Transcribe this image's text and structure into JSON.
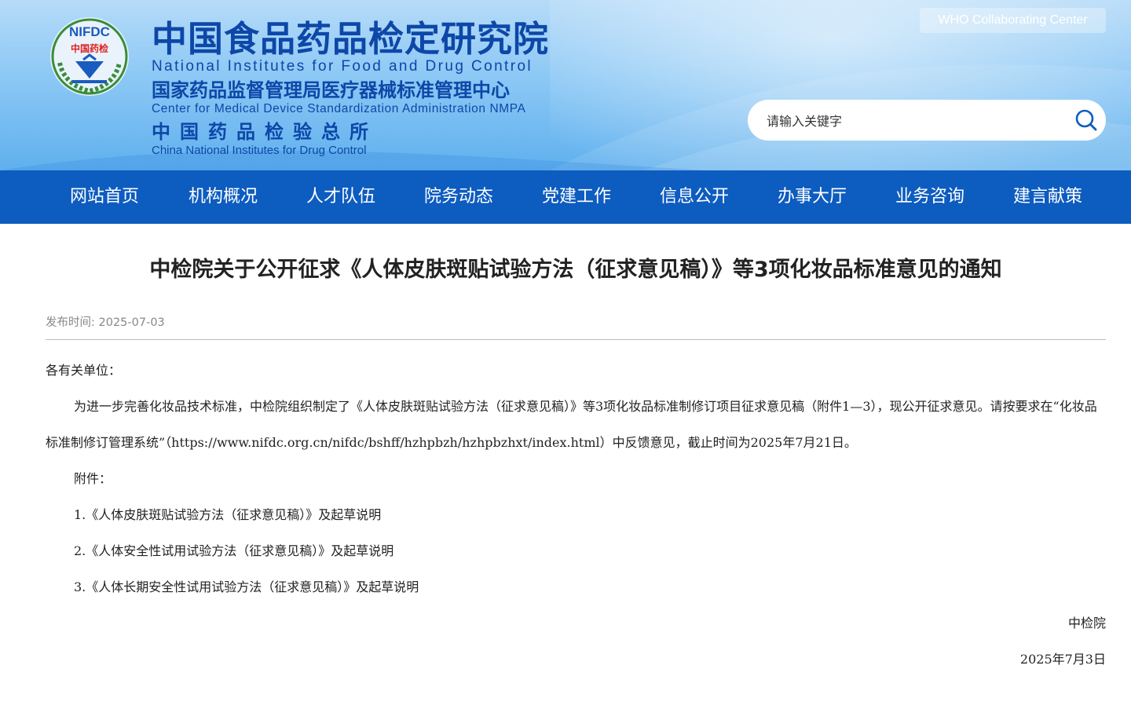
{
  "header": {
    "logo_ring_text": "NIFDC",
    "logo_center_text": "中国药检",
    "cn_title": "中国食品药品检定研究院",
    "en_title": "National Institutes for Food and Drug Control",
    "cn_sub1": "国家药品监督管理局医疗器械标准管理中心",
    "en_sub1": "Center for Medical Device Standardization Administration NMPA",
    "cn_sub2": "中国药品检验总所",
    "en_sub2": "China National Institutes for Drug Control",
    "who_badge": "WHO Collaborating Center",
    "search_placeholder": "请输入关键字",
    "colors": {
      "title": "#0d47a8",
      "nav": "#0d5cc0"
    }
  },
  "nav": {
    "items": [
      "网站首页",
      "机构概况",
      "人才队伍",
      "院务动态",
      "党建工作",
      "信息公开",
      "办事大厅",
      "业务咨询",
      "建言献策"
    ]
  },
  "article": {
    "title": "中检院关于公开征求《人体皮肤斑贴试验方法（征求意见稿）》等3项化妆品标准意见的通知",
    "publish_label": "发布时间:",
    "publish_date": "2025-07-03",
    "salutation": "各有关单位：",
    "body": "为进一步完善化妆品技术标准，中检院组织制定了《人体皮肤斑贴试验方法（征求意见稿）》等3项化妆品标准制修订项目征求意见稿（附件1—3），现公开征求意见。请按要求在“化妆品标准制修订管理系统”（https://www.nifdc.org.cn/nifdc/bshff/hzhpbzh/hzhpbzhxt/index.html）中反馈意见，截止时间为2025年7月21日。",
    "attachments_label": "附件：",
    "attachments": [
      "1.《人体皮肤斑贴试验方法（征求意见稿）》及起草说明",
      "2.《人体安全性试用试验方法（征求意见稿）》及起草说明",
      "3.《人体长期安全性试用试验方法（征求意见稿）》及起草说明"
    ],
    "signature": "中检院",
    "sign_date": "2025年7月3日"
  }
}
